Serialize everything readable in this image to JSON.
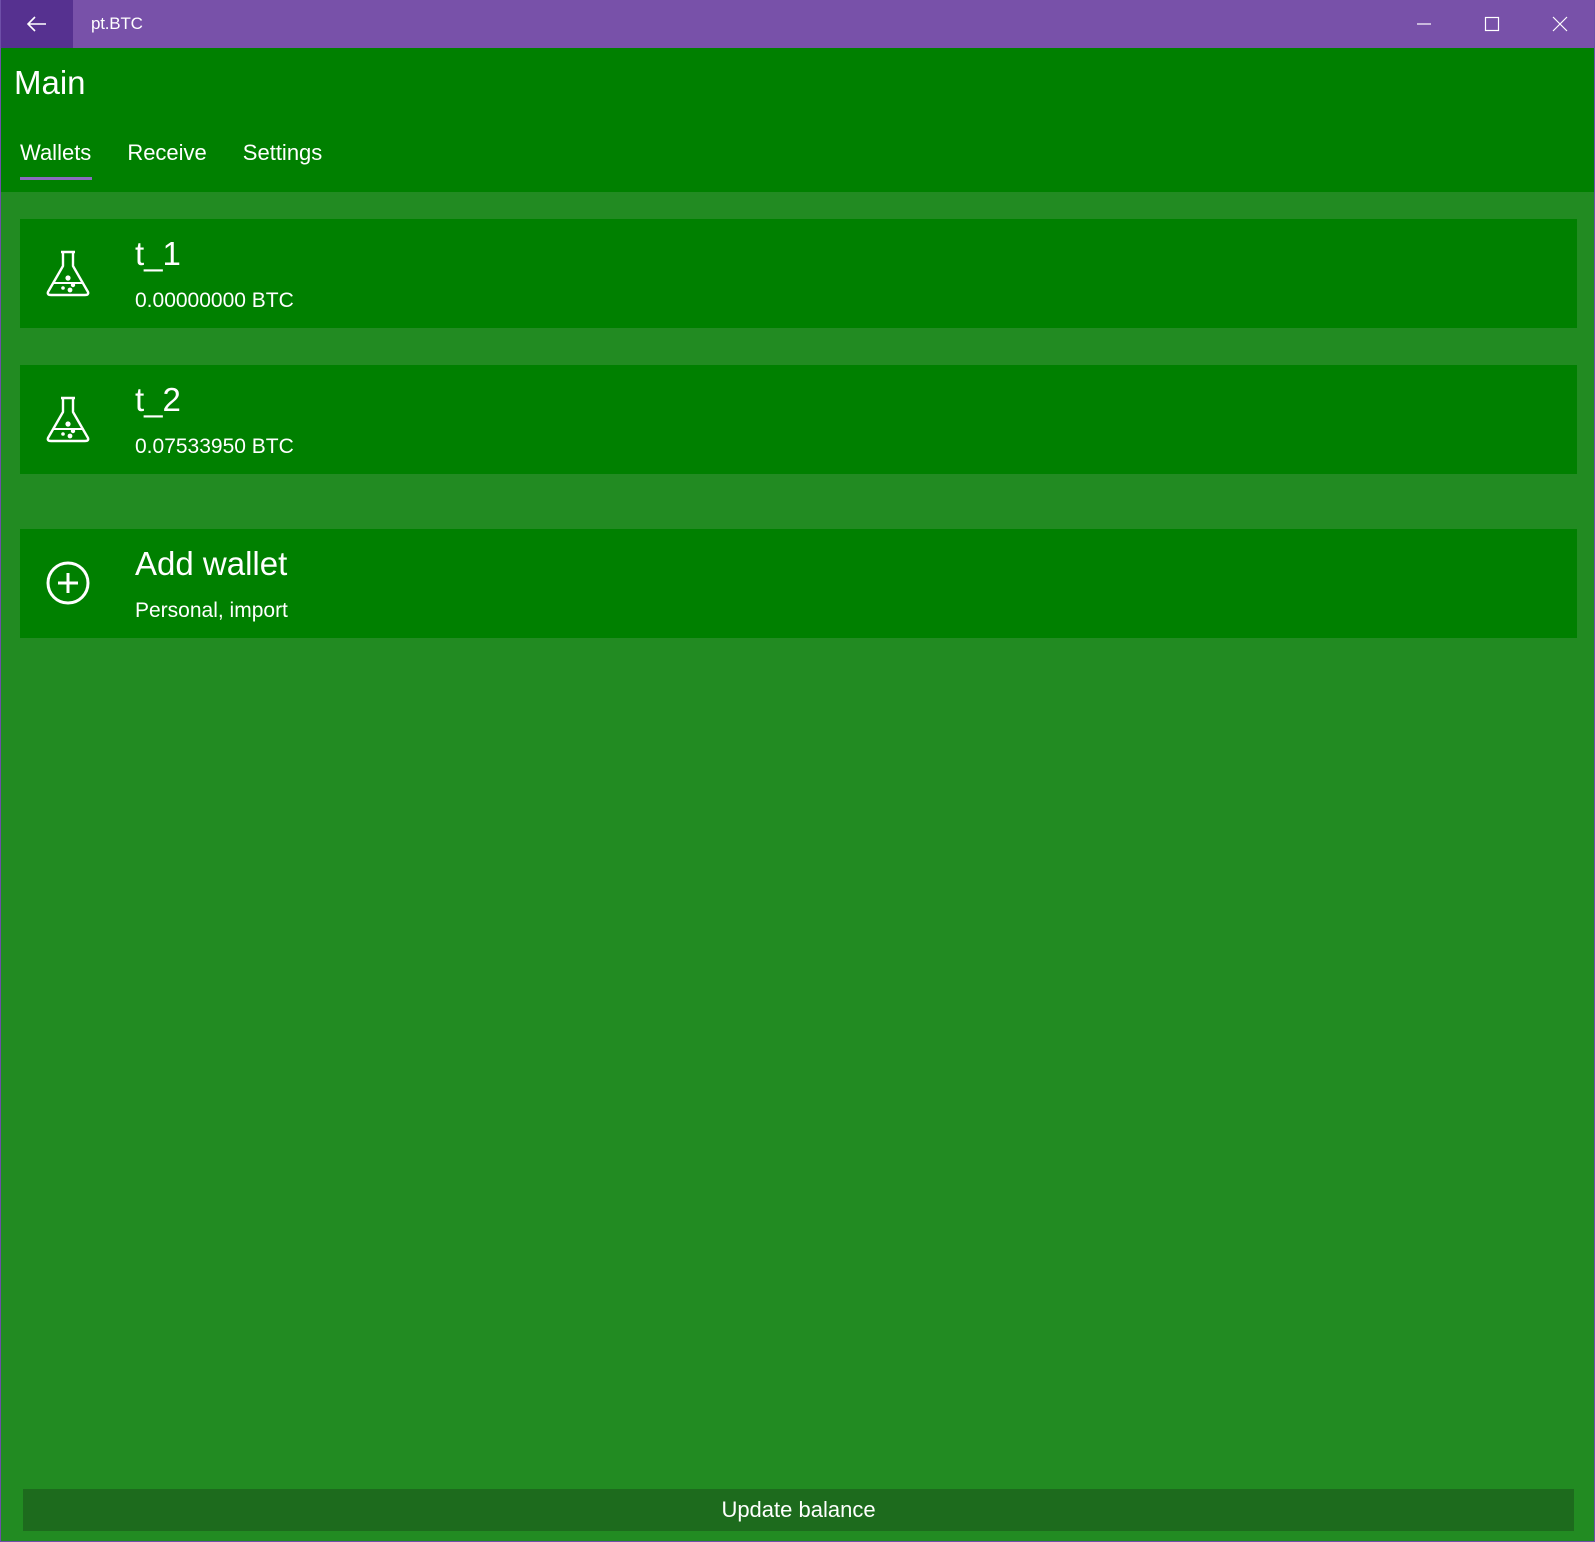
{
  "window": {
    "title": "pt.BTC"
  },
  "header": {
    "page_title": "Main",
    "tabs": [
      {
        "label": "Wallets",
        "active": true
      },
      {
        "label": "Receive",
        "active": false
      },
      {
        "label": "Settings",
        "active": false
      }
    ]
  },
  "wallets": [
    {
      "name": "t_1",
      "balance": "0.00000000 BTC",
      "icon": "flask-icon"
    },
    {
      "name": "t_2",
      "balance": "0.07533950 BTC",
      "icon": "flask-icon"
    }
  ],
  "add_wallet": {
    "title": "Add wallet",
    "subtitle": "Personal, import",
    "icon": "plus-circle-icon"
  },
  "footer": {
    "update_label": "Update balance"
  },
  "colors": {
    "titlebar": "#7851A9",
    "back_button": "#563190",
    "header": "#008000",
    "card": "#008000",
    "content_bg": "#228B22",
    "update_button": "#1d6b1d",
    "tab_indicator": "#8a6dbf"
  }
}
